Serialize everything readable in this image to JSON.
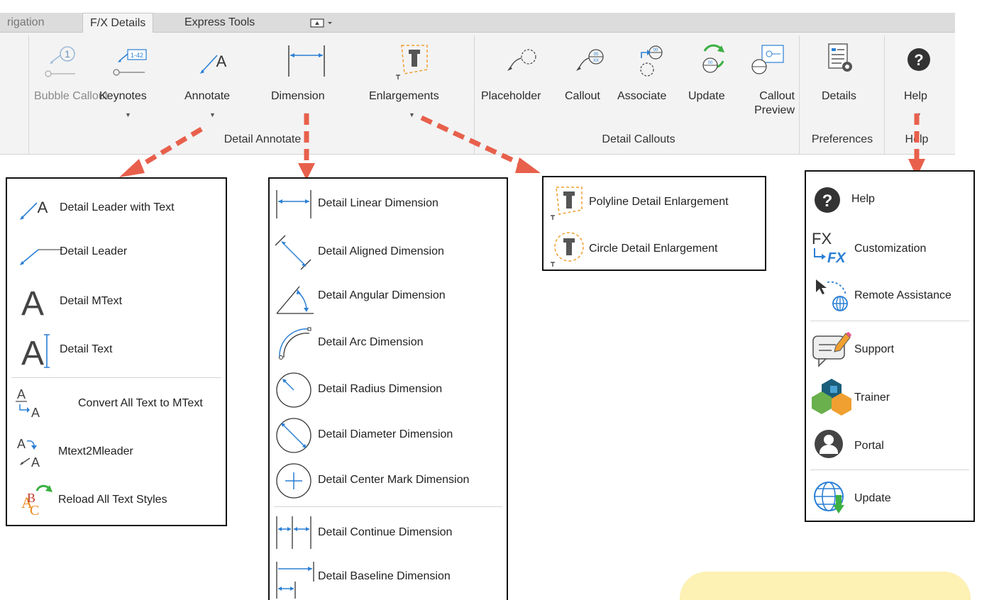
{
  "ribbon": {
    "tabs": [
      "rigation",
      "F/X Details",
      "Express Tools"
    ],
    "tab_extra_icon": "panel-options-icon",
    "buttons": {
      "bubble_callout": "Bubble Callout",
      "keynotes": "Keynotes",
      "annotate": "Annotate",
      "dimension": "Dimension",
      "enlargements": "Enlargements",
      "placeholder": "Placeholder",
      "callout": "Callout",
      "associate": "Associate",
      "update": "Update",
      "callout_preview": "Callout Preview",
      "details": "Details",
      "help": "Help"
    },
    "groups": {
      "detail_annotate": "Detail Annotate",
      "detail_callouts": "Detail Callouts",
      "preferences": "Preferences",
      "help": "Help"
    },
    "keynote_icon_text": "1-42",
    "bubble_icon_text": "1"
  },
  "annotate_menu": {
    "items": [
      "Detail Leader with Text",
      "Detail Leader",
      "Detail MText",
      "Detail Text",
      "Convert All Text to MText",
      "Mtext2Mleader",
      "Reload All Text Styles"
    ]
  },
  "dimension_menu": {
    "items": [
      "Detail Linear Dimension",
      "Detail Aligned Dimension",
      "Detail Angular Dimension",
      "Detail Arc Dimension",
      "Detail Radius Dimension",
      "Detail Diameter Dimension",
      "Detail Center Mark Dimension",
      "Detail Continue Dimension",
      "Detail Baseline Dimension"
    ]
  },
  "enlargement_menu": {
    "items": [
      "Polyline Detail Enlargement",
      "Circle Detail Enlargement"
    ]
  },
  "help_menu": {
    "items": [
      "Help",
      "Customization",
      "Remote Assistance",
      "Support",
      "Trainer",
      "Portal",
      "Update"
    ],
    "fx_logo_text": "FX"
  },
  "colors": {
    "accent_blue": "#2a7fd4",
    "arrow_red": "#e8604c",
    "enlargement_orange": "#f0a030",
    "ribbon_bg": "#f3f3f3",
    "note_bg": "#fdf1b4"
  }
}
